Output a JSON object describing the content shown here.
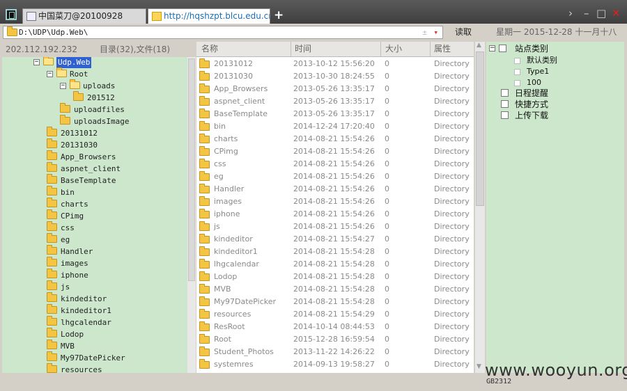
{
  "tabs": [
    {
      "label": "中国菜刀@20100928",
      "active": false
    },
    {
      "label": "http://hqshzpt.blcu.edu.cn//...",
      "active": true
    }
  ],
  "window": {
    "new_tab": "+",
    "chevron": "›",
    "minimize": "–",
    "maximize": "□",
    "close": "✕"
  },
  "pathbar": {
    "path": "D:\\UDP\\Udp.Web\\",
    "read_button": "读取",
    "date": "星期一 2015-12-28 十一月十八",
    "plus": "±",
    "dropdown": "▾"
  },
  "left": {
    "ip": "202.112.192.232",
    "counts": "目录(32),文件(18)"
  },
  "tree": [
    {
      "label": "Udp.Web",
      "level": 0,
      "expander": "−",
      "selected": true
    },
    {
      "label": "Root",
      "level": 1,
      "expander": "−"
    },
    {
      "label": "uploads",
      "level": 2,
      "expander": "−"
    },
    {
      "label": "201512",
      "level": 3
    },
    {
      "label": "uploadfiles",
      "level": 2
    },
    {
      "label": "uploadsImage",
      "level": 2
    },
    {
      "label": "20131012",
      "level": 1
    },
    {
      "label": "20131030",
      "level": 1
    },
    {
      "label": "App_Browsers",
      "level": 1
    },
    {
      "label": "aspnet_client",
      "level": 1
    },
    {
      "label": "BaseTemplate",
      "level": 1
    },
    {
      "label": "bin",
      "level": 1
    },
    {
      "label": "charts",
      "level": 1
    },
    {
      "label": "CPimg",
      "level": 1
    },
    {
      "label": "css",
      "level": 1
    },
    {
      "label": "eg",
      "level": 1
    },
    {
      "label": "Handler",
      "level": 1
    },
    {
      "label": "images",
      "level": 1
    },
    {
      "label": "iphone",
      "level": 1
    },
    {
      "label": "js",
      "level": 1
    },
    {
      "label": "kindeditor",
      "level": 1
    },
    {
      "label": "kindeditor1",
      "level": 1
    },
    {
      "label": "lhgcalendar",
      "level": 1
    },
    {
      "label": "Lodop",
      "level": 1
    },
    {
      "label": "MVB",
      "level": 1
    },
    {
      "label": "My97DatePicker",
      "level": 1
    },
    {
      "label": "resources",
      "level": 1
    }
  ],
  "list": {
    "columns": [
      "名称",
      "时间",
      "大小",
      "属性"
    ],
    "rows": [
      {
        "name": "20131012",
        "time": "2013-10-12 15:56:20",
        "size": "0",
        "attr": "Directory"
      },
      {
        "name": "20131030",
        "time": "2013-10-30 18:24:55",
        "size": "0",
        "attr": "Directory"
      },
      {
        "name": "App_Browsers",
        "time": "2013-05-26 13:35:17",
        "size": "0",
        "attr": "Directory"
      },
      {
        "name": "aspnet_client",
        "time": "2013-05-26 13:35:17",
        "size": "0",
        "attr": "Directory"
      },
      {
        "name": "BaseTemplate",
        "time": "2013-05-26 13:35:17",
        "size": "0",
        "attr": "Directory"
      },
      {
        "name": "bin",
        "time": "2014-12-24 17:20:40",
        "size": "0",
        "attr": "Directory"
      },
      {
        "name": "charts",
        "time": "2014-08-21 15:54:26",
        "size": "0",
        "attr": "Directory"
      },
      {
        "name": "CPimg",
        "time": "2014-08-21 15:54:26",
        "size": "0",
        "attr": "Directory"
      },
      {
        "name": "css",
        "time": "2014-08-21 15:54:26",
        "size": "0",
        "attr": "Directory"
      },
      {
        "name": "eg",
        "time": "2014-08-21 15:54:26",
        "size": "0",
        "attr": "Directory"
      },
      {
        "name": "Handler",
        "time": "2014-08-21 15:54:26",
        "size": "0",
        "attr": "Directory"
      },
      {
        "name": "images",
        "time": "2014-08-21 15:54:26",
        "size": "0",
        "attr": "Directory"
      },
      {
        "name": "iphone",
        "time": "2014-08-21 15:54:26",
        "size": "0",
        "attr": "Directory"
      },
      {
        "name": "js",
        "time": "2014-08-21 15:54:26",
        "size": "0",
        "attr": "Directory"
      },
      {
        "name": "kindeditor",
        "time": "2014-08-21 15:54:27",
        "size": "0",
        "attr": "Directory"
      },
      {
        "name": "kindeditor1",
        "time": "2014-08-21 15:54:28",
        "size": "0",
        "attr": "Directory"
      },
      {
        "name": "lhgcalendar",
        "time": "2014-08-21 15:54:28",
        "size": "0",
        "attr": "Directory"
      },
      {
        "name": "Lodop",
        "time": "2014-08-21 15:54:28",
        "size": "0",
        "attr": "Directory"
      },
      {
        "name": "MVB",
        "time": "2014-08-21 15:54:28",
        "size": "0",
        "attr": "Directory"
      },
      {
        "name": "My97DatePicker",
        "time": "2014-08-21 15:54:28",
        "size": "0",
        "attr": "Directory"
      },
      {
        "name": "resources",
        "time": "2014-08-21 15:54:29",
        "size": "0",
        "attr": "Directory"
      },
      {
        "name": "ResRoot",
        "time": "2014-10-14 08:44:53",
        "size": "0",
        "attr": "Directory"
      },
      {
        "name": "Root",
        "time": "2015-12-28 16:59:54",
        "size": "0",
        "attr": "Directory"
      },
      {
        "name": "Student_Photos",
        "time": "2013-11-22 14:26:22",
        "size": "0",
        "attr": "Directory"
      },
      {
        "name": "systemres",
        "time": "2014-09-13 19:58:27",
        "size": "0",
        "attr": "Directory"
      }
    ]
  },
  "right": {
    "items": [
      {
        "label": "站点类别",
        "expander": "−"
      },
      {
        "label": "默认类别",
        "sub": true
      },
      {
        "label": "Type1",
        "sub": true
      },
      {
        "label": "100",
        "sub": true
      },
      {
        "label": "日程提醒",
        "icon": "clock"
      },
      {
        "label": "快捷方式",
        "icon": "hand"
      },
      {
        "label": "上传下载",
        "icon": "box"
      }
    ]
  },
  "status": {
    "encoding": "GB2312",
    "watermark": "www.wooyun.org"
  },
  "colors": {
    "tree_bg": "#cce7cc",
    "selection": "#2f61d0",
    "folder": "#f4c542",
    "close": "#e02020",
    "link": "#1a6fb5"
  }
}
